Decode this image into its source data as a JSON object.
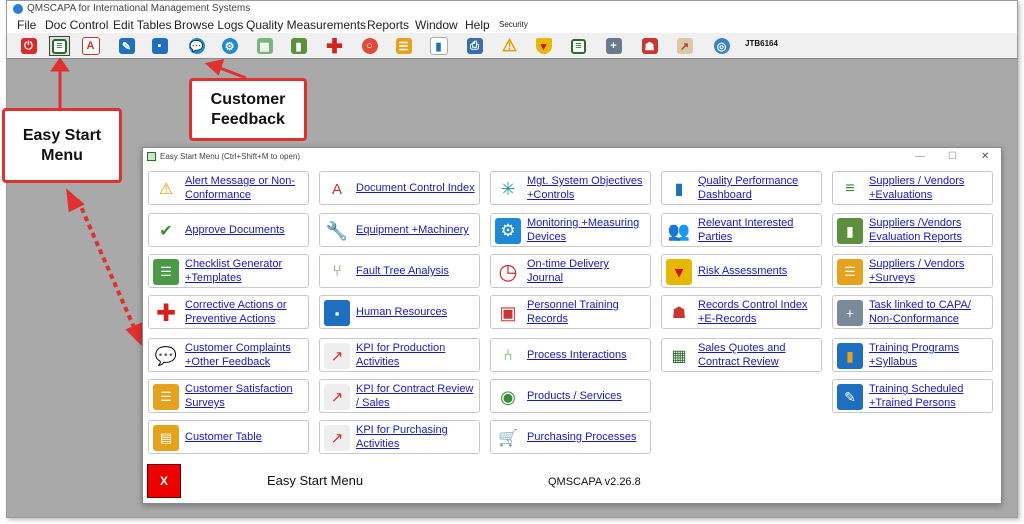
{
  "app": {
    "title": "QMSCAPA for International Management Systems"
  },
  "menu": [
    "File",
    "Doc Control",
    "Edit Tables",
    "Browse Logs",
    "Quality Measurements",
    "Reports",
    "Window",
    "Help",
    "Security"
  ],
  "toolbar": {
    "user": "JTB6164",
    "icons": [
      "power-icon",
      "easy-start-icon",
      "pdf-icon",
      "pen-icon",
      "org-chart-icon",
      "feedback-icon",
      "gear-icon",
      "calendar-icon",
      "book-icon",
      "plus-icon",
      "lifebuoy-icon",
      "checklist-icon",
      "bar-chart-icon",
      "printer-icon",
      "warning-icon",
      "shield-icon",
      "list-icon",
      "add-db-icon",
      "person-icon",
      "clipboard-chart-icon",
      "globe-icon"
    ]
  },
  "callouts": {
    "customer_feedback": "Customer Feedback",
    "easy_start": "Easy Start Menu"
  },
  "dialog": {
    "title": "Easy Start Menu (Ctrl+Shift+M to open)",
    "footer_title": "Easy Start Menu",
    "version": "QMSCAPA v2.26.8",
    "close_label": "X",
    "window_controls": [
      "—",
      "☐",
      "✕"
    ],
    "columns": [
      [
        {
          "label": "Alert Message or Non-Conformance",
          "icon": "warning-icon"
        },
        {
          "label": "Approve Documents",
          "icon": "approve-icon"
        },
        {
          "label": "Checklist Generator +Templates",
          "icon": "checklist-icon"
        },
        {
          "label": "Corrective Actions or Preventive Actions",
          "icon": "red-cross-icon"
        },
        {
          "label": "Customer Complaints +Other Feedback",
          "icon": "feedback-icon"
        },
        {
          "label": "Customer Satisfaction Surveys",
          "icon": "survey-icon"
        },
        {
          "label": "Customer Table",
          "icon": "table-icon"
        }
      ],
      [
        {
          "label": "Document Control Index",
          "icon": "pdf-icon"
        },
        {
          "label": "Equipment +Machinery",
          "icon": "wrench-icon"
        },
        {
          "label": "Fault Tree Analysis",
          "icon": "tree-icon"
        },
        {
          "label": "Human Resources",
          "icon": "org-chart-icon"
        },
        {
          "label": "KPI for Production Activities",
          "icon": "kpi-icon"
        },
        {
          "label": "KPI for Contract Review / Sales",
          "icon": "kpi-icon"
        },
        {
          "label": "KPI for Purchasing Activities",
          "icon": "kpi-icon"
        }
      ],
      [
        {
          "label": "Mgt. System Objectives +Controls",
          "icon": "network-icon"
        },
        {
          "label": "Monitoring +Measuring Devices",
          "icon": "gear-icon"
        },
        {
          "label": "On-time Delivery Journal",
          "icon": "clock-icon"
        },
        {
          "label": "Personnel Training Records",
          "icon": "training-icon"
        },
        {
          "label": "Process Interactions",
          "icon": "process-icon"
        },
        {
          "label": "Products / Services",
          "icon": "globe-icon"
        },
        {
          "label": "Purchasing Processes",
          "icon": "cart-icon"
        }
      ],
      [
        {
          "label": "Quality Performance Dashboard",
          "icon": "bar-chart-icon"
        },
        {
          "label": "Relevant Interested Parties",
          "icon": "people-icon"
        },
        {
          "label": "Risk Assessments",
          "icon": "shield-icon"
        },
        {
          "label": "Records Control Index +E-Records",
          "icon": "records-icon"
        },
        {
          "label": "Sales Quotes and Contract Review",
          "icon": "money-icon"
        }
      ],
      [
        {
          "label": "Suppliers / Vendors +Evaluations",
          "icon": "supplier-icon"
        },
        {
          "label": "Suppliers /Vendors Evaluation Reports",
          "icon": "report-icon"
        },
        {
          "label": "Suppliers / Vendors +Surveys",
          "icon": "survey-icon"
        },
        {
          "label": "Task linked to CAPA/ Non-Conformance",
          "icon": "task-icon"
        },
        {
          "label": "Training Programs +Syllabus",
          "icon": "book-icon"
        },
        {
          "label": "Training Scheduled +Trained Persons",
          "icon": "schedule-icon"
        }
      ]
    ]
  }
}
